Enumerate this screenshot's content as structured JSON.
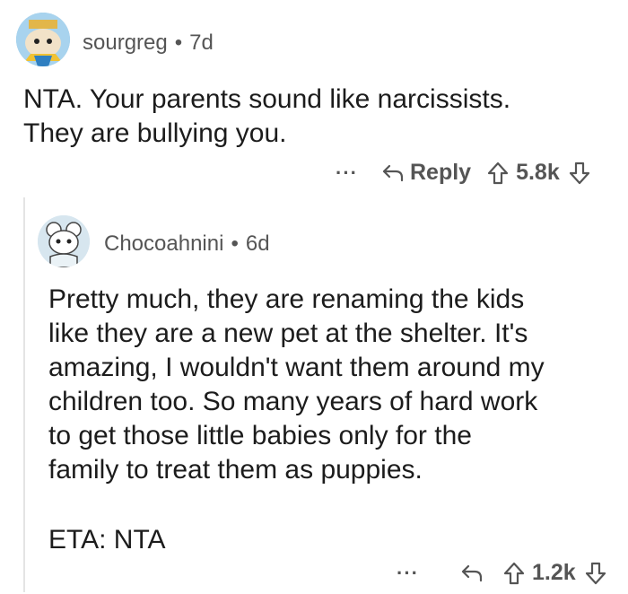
{
  "comments": [
    {
      "username": "sourgreg",
      "time": "7d",
      "body_lines": [
        "NTA. Your parents sound like narcissists.",
        "They are bullying you."
      ],
      "more": "···",
      "reply_label": "Reply",
      "votes": "5.8k"
    },
    {
      "username": "Chocoahnini",
      "time": "6d",
      "body_lines": [
        "Pretty much, they are renaming the kids",
        "like they are a new pet at the shelter. It's",
        "amazing, I wouldn't want them around my",
        "children too. So many years of hard work",
        "to get those little babies only for the",
        "family to treat them as puppies."
      ],
      "eta": "ETA: NTA",
      "more": "···",
      "votes": "1.2k"
    }
  ],
  "separator": "•"
}
